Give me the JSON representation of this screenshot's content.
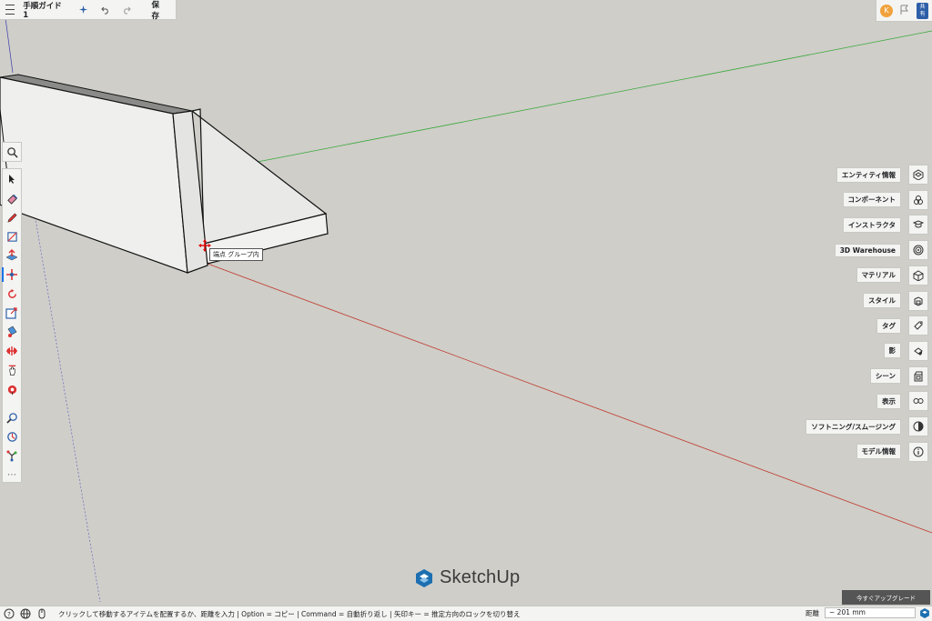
{
  "header": {
    "doc_title": "手順ガイド 1",
    "save_label": "保存",
    "menu_icon": "hamburger-icon",
    "icons": [
      "sparkle-icon",
      "undo-icon",
      "redo-icon"
    ]
  },
  "account": {
    "avatar_initial": "K",
    "share_label_line1": "共",
    "share_label_line2": "有"
  },
  "tooltip": {
    "text": "端点 グループ内"
  },
  "right_panel": {
    "items": [
      {
        "label": "エンティティ情報",
        "icon": "entity-info-icon"
      },
      {
        "label": "コンポーネント",
        "icon": "components-icon"
      },
      {
        "label": "インストラクタ",
        "icon": "instructor-icon"
      },
      {
        "label": "3D Warehouse",
        "icon": "warehouse-icon"
      },
      {
        "label": "マテリアル",
        "icon": "materials-icon"
      },
      {
        "label": "スタイル",
        "icon": "styles-icon"
      },
      {
        "label": "タグ",
        "icon": "tags-icon"
      },
      {
        "label": "影",
        "icon": "shadows-icon"
      },
      {
        "label": "シーン",
        "icon": "scenes-icon"
      },
      {
        "label": "表示",
        "icon": "display-icon"
      },
      {
        "label": "ソフトニング/スムージング",
        "icon": "soften-icon"
      },
      {
        "label": "モデル情報",
        "icon": "model-info-icon"
      }
    ]
  },
  "left_tools": [
    "select-icon",
    "eraser-icon",
    "pencil-icon",
    "shape-icon",
    "push-pull-icon",
    "move-icon",
    "rotate-icon",
    "scale-icon",
    "paint-icon",
    "flip-icon",
    "orbit-hand-icon",
    "pan-icon",
    "zoom-icon",
    "walk-icon",
    "axes-icon",
    "more-icon"
  ],
  "active_tool": "move-icon",
  "brand": {
    "name": "SketchUp"
  },
  "upgrade_label": "今すぐアップグレード",
  "status": {
    "hint": "クリックして移動するアイテムを配置するか、距離を入力 | Option = コピー | Command = 自動折り返し | 矢印キー = 推定方向のロックを切り替え",
    "measure_label": "距離",
    "measure_value": "~ 201 mm"
  },
  "colors": {
    "background": "#cfcec9",
    "accent": "#1a73e8",
    "x_axis": "#c0392b",
    "y_axis": "#3aa83a",
    "z_axis": "#4a4ab0"
  }
}
